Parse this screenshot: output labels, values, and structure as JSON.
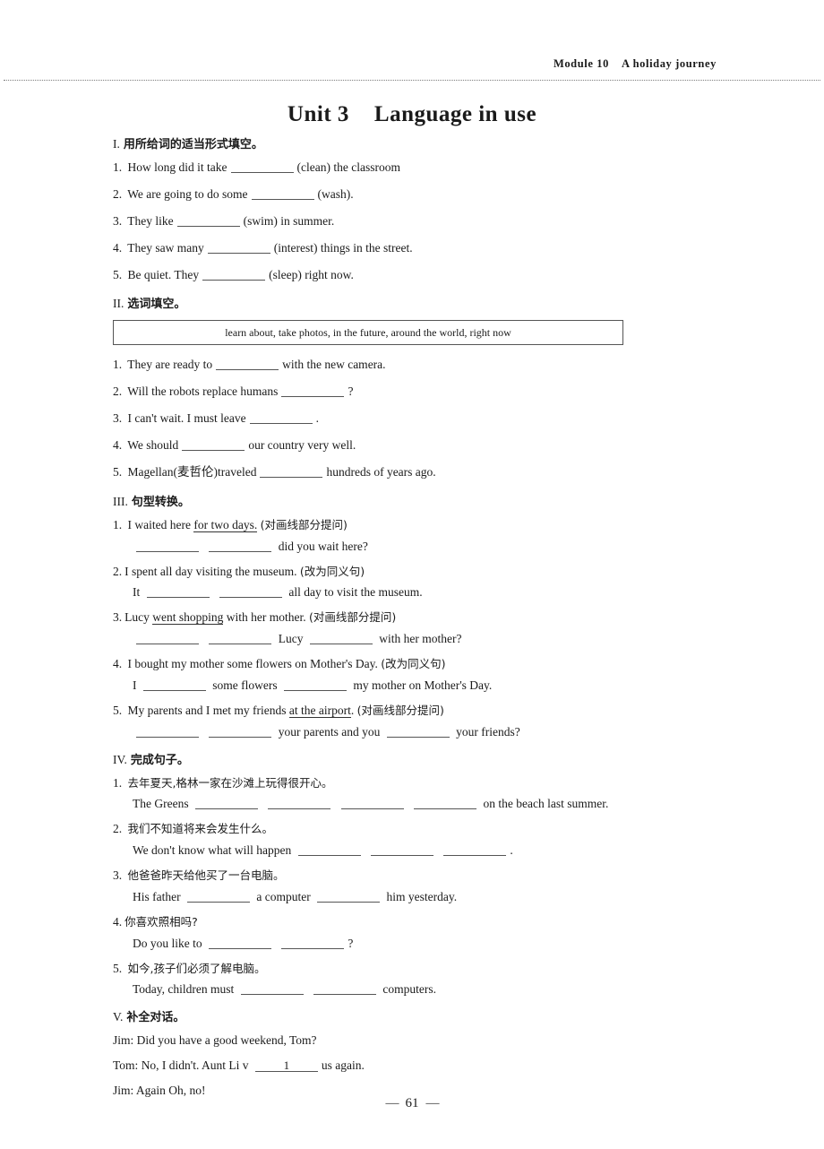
{
  "header": {
    "module": "Module 10",
    "module_title": "A holiday journey"
  },
  "title": {
    "unit": "Unit 3",
    "name": "Language in use"
  },
  "folio": {
    "dash_left": "—",
    "page_number": "61",
    "dash_right": "—"
  },
  "sections": [
    {
      "numeral": "I.",
      "heading": "用所给词的适当形式填空。",
      "items": [
        {
          "num": "1.",
          "pre": "How long did it take",
          "post": "(clean) the classroom"
        },
        {
          "num": "2.",
          "pre": "We are going to do some",
          "post": "(wash)."
        },
        {
          "num": "3.",
          "pre": "They like",
          "post": "(swim) in summer."
        },
        {
          "num": "4.",
          "pre": "They saw many",
          "post": "(interest) things in the street."
        },
        {
          "num": "5.",
          "pre": "Be quiet. They",
          "post": "(sleep) right now."
        }
      ]
    },
    {
      "numeral": "II.",
      "heading": "选词填空。",
      "word_bank": "learn about, take photos, in the future, around the world, right now",
      "items": [
        {
          "num": "1.",
          "pre": "They are ready to",
          "post": "with the new camera."
        },
        {
          "num": "2.",
          "pre": "Will the robots replace humans",
          "post": "?"
        },
        {
          "num": "3.",
          "pre": "I can't wait. I must leave",
          "post": "."
        },
        {
          "num": "4.",
          "pre": "We should",
          "post": "our country very well."
        },
        {
          "num": "5.",
          "pre": "Magellan(麦哲伦)traveled",
          "post": "hundreds of years ago."
        }
      ]
    },
    {
      "numeral": "III.",
      "heading": "句型转换。",
      "items": [
        {
          "num": "1.",
          "stem_pre": "I waited here",
          "stem_underline": "for two days.",
          "stem_note": "(对画线部分提问)",
          "answer_post": "did you wait here?"
        },
        {
          "num": "2.",
          "stem_pre": "I spent all day visiting the museum.",
          "stem_underline": "",
          "stem_note": "(改为同义句)",
          "answer_pre": "It",
          "answer_post": "all day to visit the museum."
        },
        {
          "num": "3.",
          "stem_pre": "Lucy",
          "stem_underline": "went shopping",
          "stem_tail": "with her mother.",
          "stem_note": "(对画线部分提问)",
          "answer_mid": "Lucy",
          "answer_post": "with her mother?"
        },
        {
          "num": "4.",
          "stem_pre": "I bought my mother some flowers on Mother's Day.",
          "stem_note": "(改为同义句)",
          "answer_pre": "I",
          "answer_mid": "some flowers",
          "answer_post": "my mother on Mother's Day."
        },
        {
          "num": "5.",
          "stem_pre": "My parents and I met my friends",
          "stem_underline": "at the airport",
          "stem_tail": ".",
          "stem_note": "(对画线部分提问)",
          "answer_mid": "your parents and you",
          "answer_post": "your friends?"
        }
      ]
    },
    {
      "numeral": "IV.",
      "heading": "完成句子。",
      "items": [
        {
          "num": "1.",
          "cn": "去年夏天,格林一家在沙滩上玩得很开心。",
          "en_pre": "The Greens",
          "en_post": "on the beach last summer."
        },
        {
          "num": "2.",
          "cn": "我们不知道将来会发生什么。",
          "en_pre": "We don't know what will happen",
          "en_post": "."
        },
        {
          "num": "3.",
          "cn": "他爸爸昨天给他买了一台电脑。",
          "en_pre": "His father",
          "en_mid": "a computer",
          "en_post": "him yesterday."
        },
        {
          "num": "4.",
          "cn": "你喜欢照相吗?",
          "en_pre": "Do you like to",
          "en_post": "?"
        },
        {
          "num": "5.",
          "cn": "如今,孩子们必须了解电脑。",
          "en_pre": "Today, children must",
          "en_post": "computers."
        }
      ]
    },
    {
      "numeral": "V.",
      "heading": "补全对话。",
      "dialogue": [
        {
          "speaker": "Jim:",
          "line": "Did you have a good weekend, Tom?"
        },
        {
          "speaker": "Tom:",
          "pre": "No, I didn't. Aunt Li v",
          "blank_label": "1",
          "post": "us again."
        },
        {
          "speaker": "Jim:",
          "line": "Again Oh, no!"
        }
      ]
    }
  ]
}
